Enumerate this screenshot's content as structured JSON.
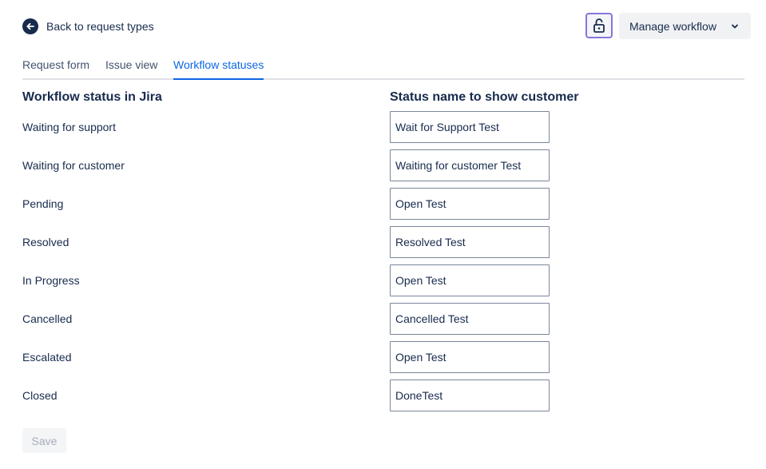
{
  "header": {
    "back_label": "Back to request types",
    "manage_label": "Manage workflow"
  },
  "tabs": [
    {
      "label": "Request form"
    },
    {
      "label": "Issue view"
    },
    {
      "label": "Workflow statuses",
      "active": true
    }
  ],
  "columns": {
    "jira": "Workflow status in Jira",
    "customer": "Status name to show customer"
  },
  "rows": [
    {
      "jira_status": "Waiting for support",
      "customer_name": "Wait for Support Test"
    },
    {
      "jira_status": "Waiting for customer",
      "customer_name": "Waiting for customer Test"
    },
    {
      "jira_status": "Pending",
      "customer_name": "Open Test"
    },
    {
      "jira_status": "Resolved",
      "customer_name": "Resolved Test"
    },
    {
      "jira_status": "In Progress",
      "customer_name": "Open Test"
    },
    {
      "jira_status": "Cancelled",
      "customer_name": "Cancelled Test"
    },
    {
      "jira_status": "Escalated",
      "customer_name": "Open Test"
    },
    {
      "jira_status": "Closed",
      "customer_name": "DoneTest"
    }
  ],
  "save_label": "Save",
  "colors": {
    "accent": "#0c66e4",
    "text": "#172b4d",
    "lock_border": "#8777d9",
    "disabled_text": "#a5adba"
  },
  "icons": {
    "back": "arrow-left-circle-icon",
    "lock": "unlock-icon",
    "chevron": "chevron-down-icon"
  }
}
